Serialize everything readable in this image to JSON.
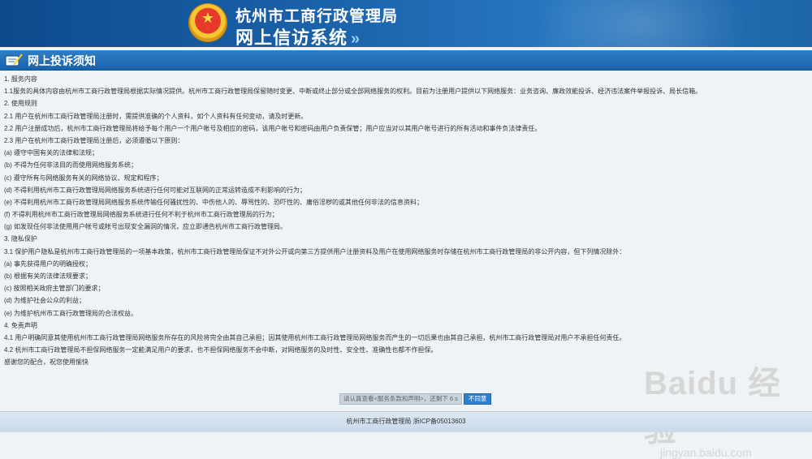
{
  "header": {
    "title": "杭州市工商行政管理局",
    "subtitle": "网上信访系统",
    "subtitle_arrows": "»"
  },
  "section_bar": {
    "title": "网上投诉须知"
  },
  "content": {
    "lines": [
      "1. 服务内容",
      "1.1服务的具体内容由杭州市工商行政管理局根据实际情况提供。杭州市工商行政管理局保留随时变更、中断或终止部分或全部网络服务的权利。目前为注册用户提供以下网络服务：业务咨询、廉政效能投诉、经济违法案件举报投诉、局长信箱。",
      "2. 使用规则",
      "2.1 用户在杭州市工商行政管理局注册时，需提供准确的个人资料，如个人资料有任何变动，请及时更新。",
      "2.2 用户注册成功后，杭州市工商行政管理局将给予每个用户一个用户帐号及相应的密码，该用户帐号和密码由用户负责保管；用户应当对以其用户帐号进行的所有活动和事件负法律责任。",
      "2.3 用户在杭州市工商行政管理局注册后，必须遵循以下原则：",
      "(a) 遵守中国有关的法律和法规；",
      "(b) 不得为任何非法目的而使用网络服务系统；",
      "(c) 遵守所有与网络服务有关的网络协议、规定和程序；",
      "(d) 不得利用杭州市工商行政管理局网络服务系统进行任何可能对互联网的正常运转造成不利影响的行为；",
      "(e) 不得利用杭州市工商行政管理局网络服务系统传输任何骚扰性的、中伤他人的、辱骂性的、恐吓性的、庸俗淫秽的或其他任何非法的信息资料；",
      "(f) 不得利用杭州市工商行政管理局网络服务系统进行任何不利于杭州市工商行政管理局的行为；",
      "(g) 如发现任何非法使用用户帐号或帐号出现安全漏洞的情况，应立即通告杭州市工商行政管理局。",
      "3. 隐私保护",
      "3.1 保护用户隐私是杭州市工商行政管理局的一项基本政策，杭州市工商行政管理局保证不对外公开或向第三方提供用户注册资料及用户在使用网络服务时存储在杭州市工商行政管理局的非公开内容，但下列情况除外：",
      "(a) 事先获得用户的明确授权；",
      "(b) 根据有关的法律法规要求；",
      "(c) 按照相关政府主管部门的要求；",
      "(d) 为维护社会公众的利益；",
      "(e) 为维护杭州市工商行政管理局的合法权益。",
      "4. 免责声明",
      "4.1 用户明确同意其使用杭州市工商行政管理局网络服务所存在的风险将完全由其自己承担；因其使用杭州市工商行政管理局网络服务而产生的一切后果也由其自己承担，杭州市工商行政管理局对用户不承担任何责任。",
      "4.2 杭州市工商行政管理局不担保网络服务一定能满足用户的要求，也不担保网络服务不会中断，对网络服务的及时性、安全性、准确性也都不作担保。",
      "感谢您的配合，祝您使用愉快"
    ]
  },
  "actions": {
    "agree_label": "请认真查看<服务条款和声明>，还剩下 6 s",
    "disagree_label": "不同意"
  },
  "footer": {
    "text": "杭州市工商行政管理局 浙ICP备05013603"
  },
  "watermark": {
    "brand": "Baidu 经验",
    "url": "jingyan.baidu.com"
  },
  "colors": {
    "header_bg": "#1a62aa",
    "bar_bg": "#2f7fc6",
    "button_bg": "#2f7fd0",
    "page_bg": "#eef3f6"
  }
}
